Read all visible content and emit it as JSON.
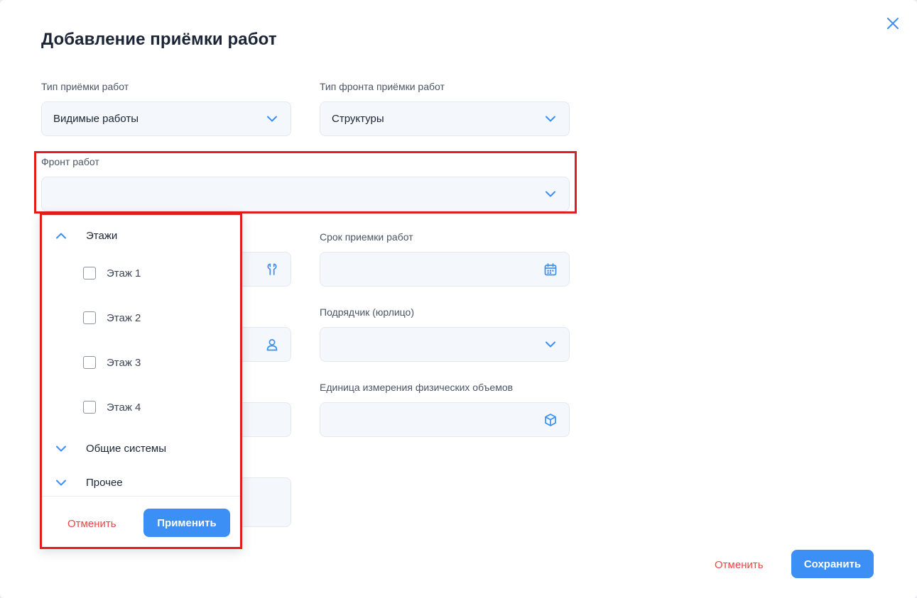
{
  "title": "Добавление приёмки работ",
  "fields": {
    "acceptance_type": {
      "label": "Тип приёмки работ",
      "value": "Видимые работы"
    },
    "front_type": {
      "label": "Тип фронта приёмки работ",
      "value": "Структуры"
    },
    "work_front": {
      "label": "Фронт работ",
      "value": ""
    },
    "deadline": {
      "label": "Срок приемки работ",
      "value": ""
    },
    "contractor": {
      "label": "Подрядчик (юрлицо)",
      "value": ""
    },
    "unit": {
      "label": "Единица измерения физических объемов",
      "value": ""
    }
  },
  "dropdown": {
    "groups": [
      {
        "label": "Этажи",
        "expanded": true,
        "options": [
          {
            "label": "Этаж 1",
            "checked": false
          },
          {
            "label": "Этаж 2",
            "checked": false
          },
          {
            "label": "Этаж 3",
            "checked": false
          },
          {
            "label": "Этаж 4",
            "checked": false
          }
        ]
      },
      {
        "label": "Общие системы",
        "expanded": false
      },
      {
        "label": "Прочее",
        "expanded": false
      }
    ],
    "cancel_label": "Отменить",
    "apply_label": "Применить"
  },
  "footer": {
    "cancel_label": "Отменить",
    "save_label": "Сохранить"
  },
  "colors": {
    "accent": "#3b8ff5",
    "danger": "#ef4444",
    "highlight": "#e11d1d"
  },
  "icons": [
    "close-icon",
    "chevron-down-icon",
    "chevron-up-icon",
    "wrench-icon",
    "user-icon",
    "calendar-icon",
    "cube-icon"
  ]
}
